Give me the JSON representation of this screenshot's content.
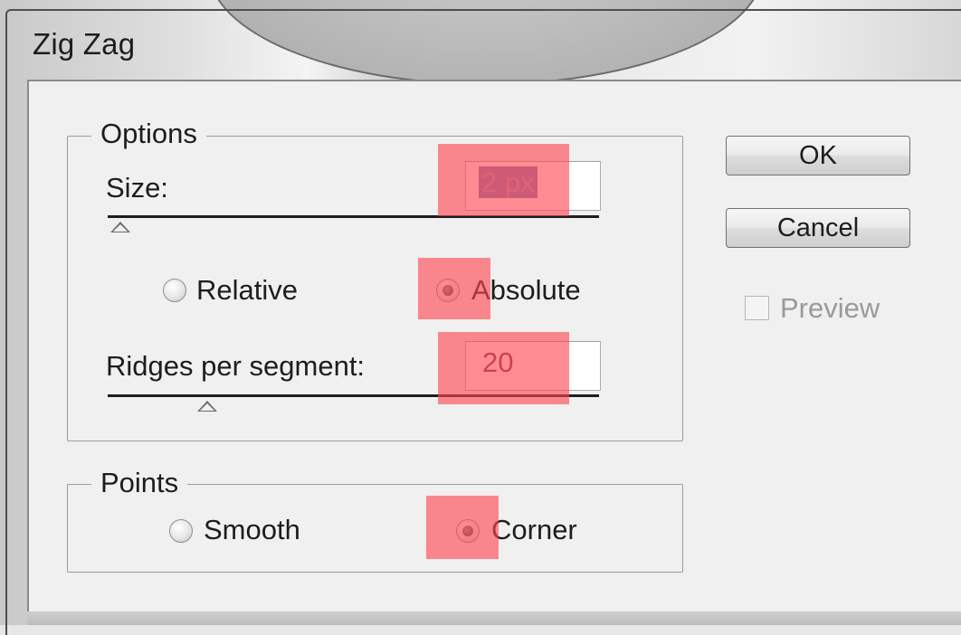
{
  "window": {
    "title": "Zig Zag"
  },
  "options_group": {
    "legend": "Options",
    "size": {
      "label": "Size:",
      "value": "2 px",
      "slider_fraction": 0.02
    },
    "mode": {
      "relative_label": "Relative",
      "absolute_label": "Absolute",
      "selected": "Absolute"
    },
    "ridges": {
      "label": "Ridges per segment:",
      "value": "20",
      "slider_fraction": 0.2
    }
  },
  "points_group": {
    "legend": "Points",
    "smooth_label": "Smooth",
    "corner_label": "Corner",
    "selected": "Corner"
  },
  "buttons": {
    "ok_label": "OK",
    "cancel_label": "Cancel"
  },
  "preview": {
    "label": "Preview",
    "checked": false,
    "enabled": false
  },
  "colors": {
    "highlight": "#ff4650",
    "selection": "#7b7eb0",
    "dialog_bg": "#f0f0f0"
  }
}
